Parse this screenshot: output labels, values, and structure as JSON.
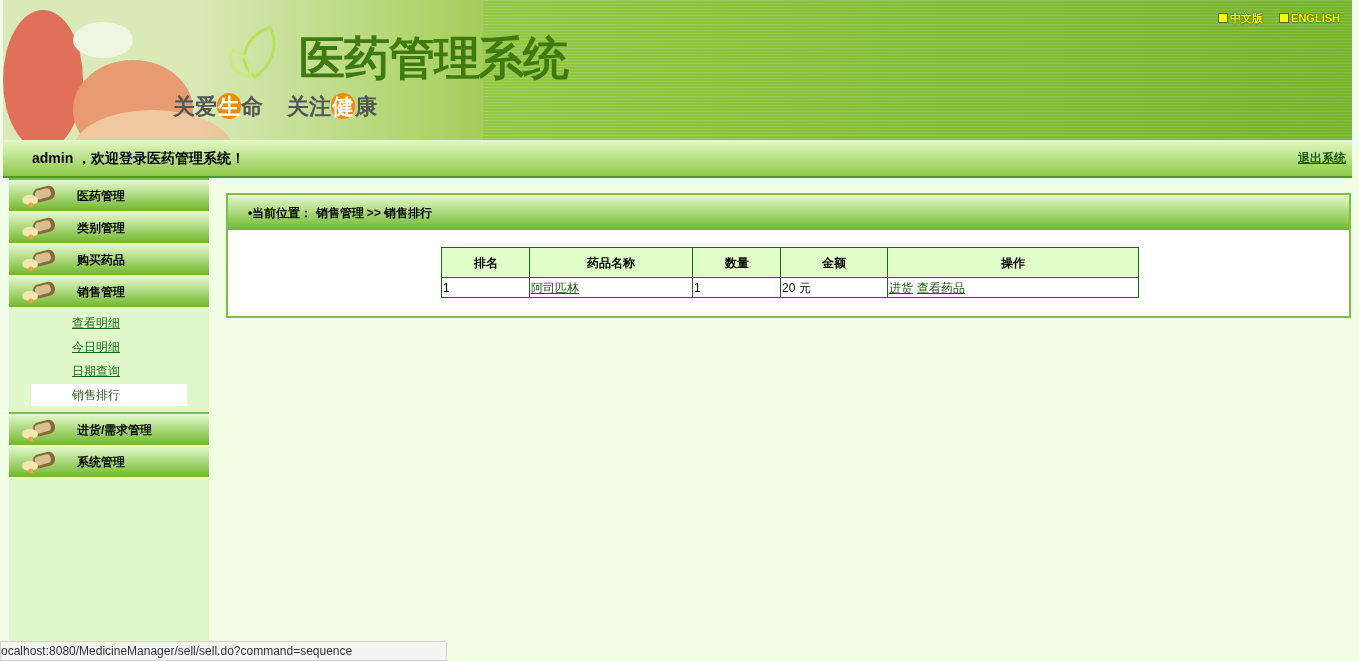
{
  "header": {
    "title": "医药管理系统",
    "slogan": [
      "关爱",
      "生",
      "命",
      "关注",
      "健",
      "康"
    ],
    "languages": [
      "中文版",
      "ENGLISH"
    ]
  },
  "welcome": {
    "text": "admin ，欢迎登录医药管理系统！",
    "logout": "退出系统"
  },
  "sidebar": {
    "items": [
      {
        "label": "医药管理"
      },
      {
        "label": "类别管理"
      },
      {
        "label": "购买药品"
      },
      {
        "label": "销售管理",
        "children": [
          {
            "label": "查看明细",
            "selected": false
          },
          {
            "label": "今日明细",
            "selected": false
          },
          {
            "label": "日期查询",
            "selected": false
          },
          {
            "label": "销售排行",
            "selected": true
          }
        ]
      },
      {
        "label": "进货/需求管理"
      },
      {
        "label": "系统管理"
      }
    ]
  },
  "breadcrumb": "•当前位置： 销售管理 >> 销售排行",
  "table": {
    "columns": [
      "排名",
      "药品名称",
      "数量",
      "金额",
      "操作"
    ],
    "rows": [
      {
        "rank": "1",
        "name": "阿司匹林",
        "quantity": "1",
        "amount": "20 元",
        "actions": [
          "进货",
          "查看药品"
        ]
      }
    ]
  },
  "status_bar": "ocalhost:8080/MedicineManager/sell/sell.do?command=sequence"
}
